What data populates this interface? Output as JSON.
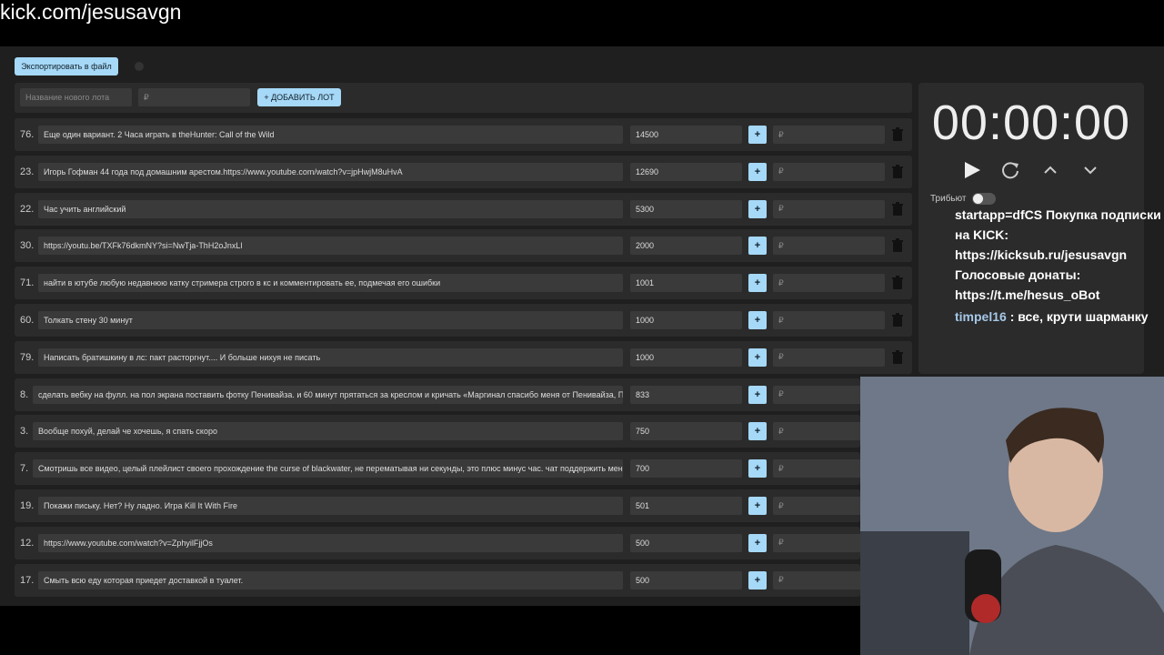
{
  "url": "kick.com/jesusavgn",
  "toolbar": {
    "export_label": "Экспортировать в файл"
  },
  "add_form": {
    "name_placeholder": "Название нового лота",
    "amount_placeholder": "₽",
    "add_button": "+ ДОБАВИТЬ ЛОТ"
  },
  "lots": [
    {
      "num": "76.",
      "name": "Еще один вариант. 2 Часа играть в theHunter: Call of the Wild",
      "amount": "14500",
      "plus": "+",
      "rub": "₽"
    },
    {
      "num": "23.",
      "name": "Игорь Гофман 44 года под домашним арестом.https://www.youtube.com/watch?v=jpHwjM8uHvA",
      "amount": "12690",
      "plus": "+",
      "rub": "₽"
    },
    {
      "num": "22.",
      "name": "Час учить английский",
      "amount": "5300",
      "plus": "+",
      "rub": "₽"
    },
    {
      "num": "30.",
      "name": "https://youtu.be/TXFk76dkmNY?si=NwTja-ThH2oJnxLl",
      "amount": "2000",
      "plus": "+",
      "rub": "₽"
    },
    {
      "num": "71.",
      "name": "найти в ютубе любую недавнюю катку стримера строго в кс и комментировать ее, подмечая его ошибки",
      "amount": "1001",
      "plus": "+",
      "rub": "₽"
    },
    {
      "num": "60.",
      "name": "Толкать стену 30 минут",
      "amount": "1000",
      "plus": "+",
      "rub": "₽"
    },
    {
      "num": "79.",
      "name": "Написать братишкину в лс: пакт расторгнут.... И больше нихуя не писать",
      "amount": "1000",
      "plus": "+",
      "rub": "₽"
    },
    {
      "num": "8.",
      "name": "сделать вебку на фулл. на пол экрана поставить фотку Пенивайза. и 60 минут прятаться за креслом и кричать «Маргинал спасибо меня от Пенивайза, Пе",
      "amount": "833",
      "plus": "+",
      "rub": "₽"
    },
    {
      "num": "3.",
      "name": "Вообще похуй, делай че хочешь, я спать скоро",
      "amount": "750",
      "plus": "+",
      "rub": "₽"
    },
    {
      "num": "7.",
      "name": "Смотришь все видео, целый плейлист своего прохождение the curse of blackwater, не перематывая ни секунды, это плюс минус час. чат поддержить меня",
      "amount": "700",
      "plus": "+",
      "rub": "₽"
    },
    {
      "num": "19.",
      "name": "Покажи письку. Нет? Ну ладно. Игра Kill It With Fire",
      "amount": "501",
      "plus": "+",
      "rub": "₽"
    },
    {
      "num": "12.",
      "name": "https://www.youtube.com/watch?v=ZphyilFjjOs",
      "amount": "500",
      "plus": "+",
      "rub": "₽"
    },
    {
      "num": "17.",
      "name": "Смыть всю еду которая приедет доставкой в туалет.",
      "amount": "500",
      "plus": "+",
      "rub": "₽"
    }
  ],
  "timer": {
    "time": "00:00:00",
    "tribut_label": "Трибьют"
  },
  "chat": {
    "lines": [
      "startapp=dfCS Покупка подписки",
      "на KICK:",
      "https://kicksub.ru/jesusavgn",
      "Голосовые донаты:",
      "https://t.me/hesus_oBot"
    ],
    "user": "timpel16",
    "message": " : все, крути шарманку"
  },
  "icons": {
    "trash": "trash-icon",
    "play": "play-icon",
    "reset": "refresh-icon",
    "up": "chevron-up-icon",
    "down": "chevron-down-icon"
  },
  "colors": {
    "accent": "#a6d8f7",
    "panel": "#2b2b2b",
    "field": "#3a3a3a"
  }
}
